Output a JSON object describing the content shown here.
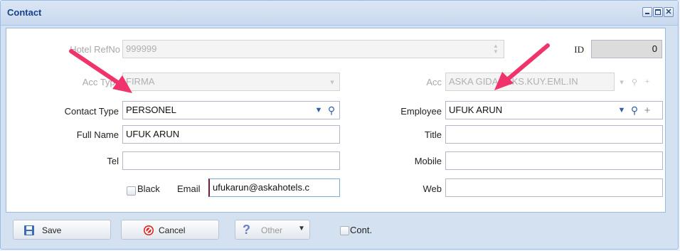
{
  "window": {
    "title": "Contact"
  },
  "form": {
    "hotel_refno": {
      "label": "Hotel RefNo",
      "value": "999999"
    },
    "id": {
      "label": "ID",
      "value": "0"
    },
    "acc_type": {
      "label": "Acc Type",
      "value": "FIRMA"
    },
    "acc": {
      "label": "Acc",
      "value": "ASKA GIDA TEKS.KUY.EML.IN"
    },
    "contact_type": {
      "label": "Contact Type",
      "value": "PERSONEL"
    },
    "employee": {
      "label": "Employee",
      "value": "UFUK ARUN"
    },
    "full_name": {
      "label": "Full Name",
      "value": "UFUK ARUN"
    },
    "title": {
      "label": "Title",
      "value": ""
    },
    "tel": {
      "label": "Tel",
      "value": ""
    },
    "mobile": {
      "label": "Mobile",
      "value": ""
    },
    "black": {
      "label": "Black",
      "checked": false
    },
    "email": {
      "label": "Email",
      "value": "ufukarun@askahotels.c"
    },
    "web": {
      "label": "Web",
      "value": ""
    }
  },
  "footer": {
    "save_label": "Save",
    "cancel_label": "Cancel",
    "other_label": "Other",
    "cont_label": "Cont.",
    "cont_checked": false
  },
  "icons": {
    "minimize": "minimize-icon",
    "maximize": "maximize-icon",
    "close": "close-icon",
    "dropdown": "chevron-down-icon",
    "search": "search-icon",
    "add": "plus-icon",
    "save": "floppy-disk-icon",
    "cancel": "no-entry-icon",
    "other": "question-mark-icon"
  },
  "colors": {
    "title": "#15428b",
    "panel": "#d3e1f1",
    "border": "#99bbe8",
    "arrow": "#f0336a"
  }
}
